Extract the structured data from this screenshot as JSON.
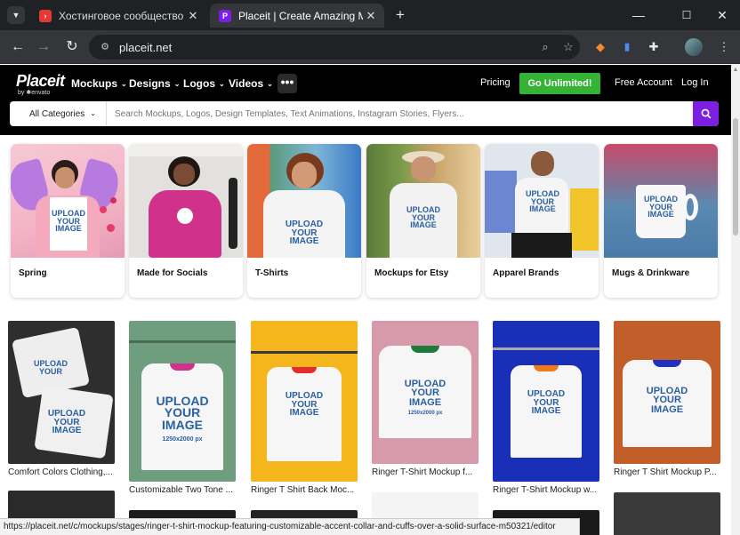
{
  "browser": {
    "tabs": [
      {
        "title": "Хостинговое сообщество «Tim",
        "favicon_letter": "›",
        "favicon_color": "#e53935"
      },
      {
        "title": "Placeit | Create Amazing Mockup",
        "favicon_letter": "P",
        "favicon_color": "#7b1fe0"
      }
    ],
    "url": "placeit.net",
    "new_tab_icon": "plus-icon"
  },
  "site": {
    "logo_main": "Placeit",
    "logo_sub": "by ✱envato",
    "nav": [
      "Mockups",
      "Designs",
      "Logos",
      "Videos"
    ],
    "more": "•••",
    "pricing": "Pricing",
    "cta": "Go Unlimited!",
    "free_account": "Free Account",
    "login": "Log In",
    "category_select": "All Categories",
    "search_placeholder": "Search Mockups, Logos, Design Templates, Text Animations, Instagram Stories, Flyers...",
    "accent": "#7b1fe0",
    "cta_color": "#35b335"
  },
  "placeholder": {
    "l1": "UPLOAD",
    "l2": "YOUR",
    "l3": "IMAGE",
    "size": "1250x2000 px"
  },
  "categories": [
    {
      "label": "Spring"
    },
    {
      "label": "Made for Socials"
    },
    {
      "label": "T-Shirts"
    },
    {
      "label": "Mockups for Etsy"
    },
    {
      "label": "Apparel Brands"
    },
    {
      "label": "Mugs & Drinkware"
    }
  ],
  "mockups": [
    {
      "caption": "Comfort Colors Clothing,..."
    },
    {
      "caption": "Customizable Two Tone ..."
    },
    {
      "caption": "Ringer T Shirt Back Moc..."
    },
    {
      "caption": "Ringer T-Shirt Mockup f..."
    },
    {
      "caption": "Ringer T-Shirt Mockup w..."
    },
    {
      "caption": "Ringer T Shirt Mockup P..."
    }
  ],
  "status_url": "https://placeit.net/c/mockups/stages/ringer-t-shirt-mockup-featuring-customizable-accent-collar-and-cuffs-over-a-solid-surface-m50321/editor"
}
